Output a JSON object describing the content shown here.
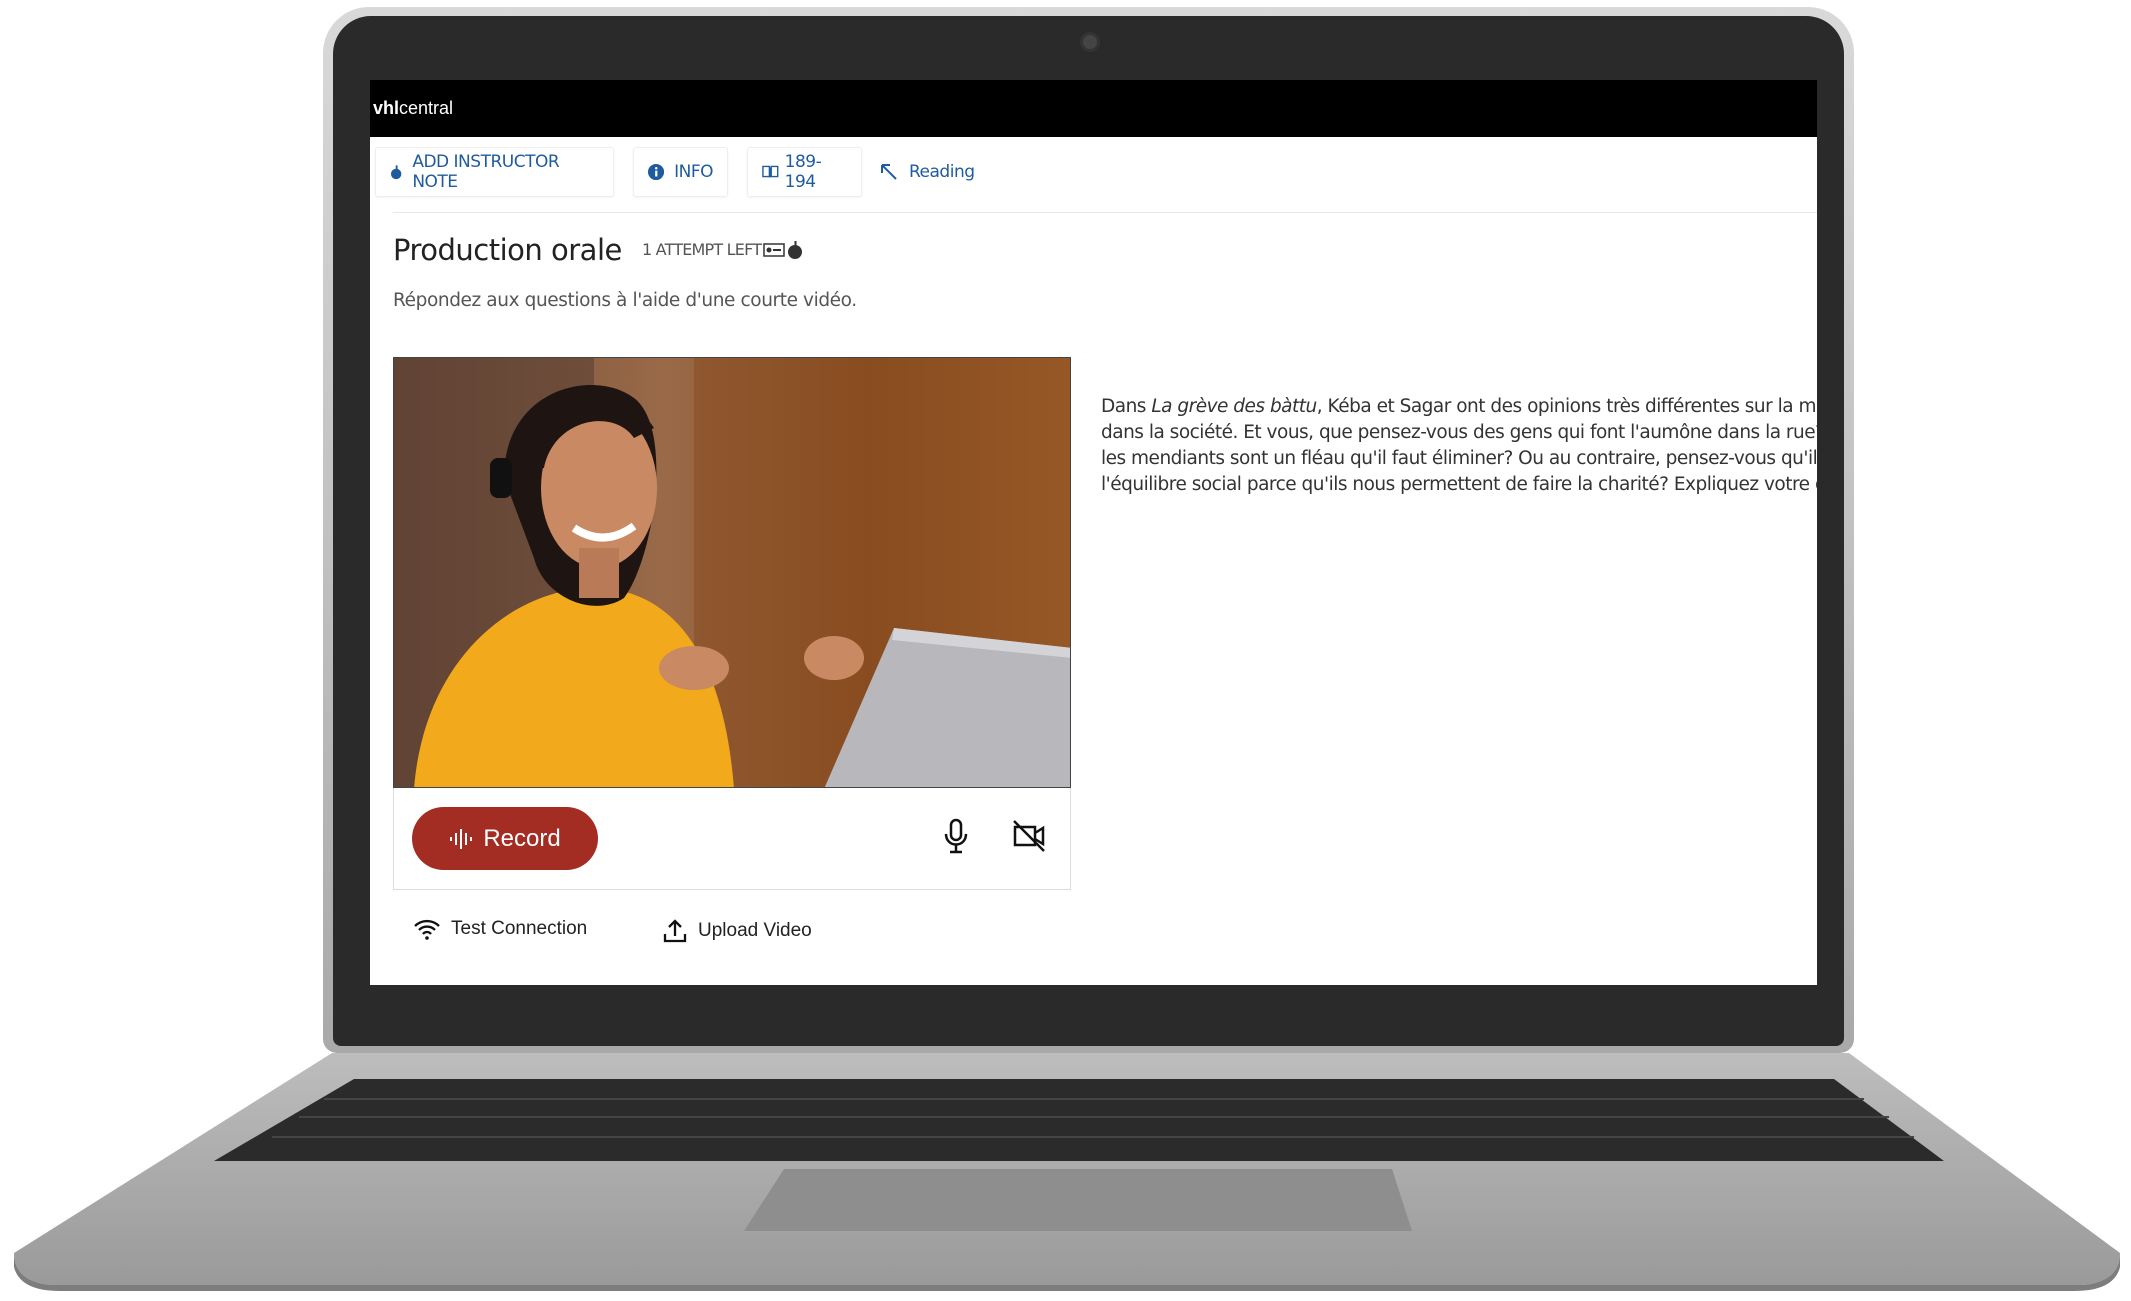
{
  "app": {
    "logo_bold": "vhl",
    "logo_rest": "central"
  },
  "toolbar": {
    "instructor_note": "ADD INSTRUCTOR NOTE",
    "info": "INFO",
    "pages": "189-194",
    "reading": "Reading"
  },
  "activity": {
    "title": "Production orale",
    "attempts": "1 ATTEMPT LEFT",
    "instructions": "Répondez aux questions à l'aide d'une courte vidéo."
  },
  "prompt": {
    "lines": [
      {
        "pre": "Dans ",
        "em": "La grève des bàttu",
        "post": ", Kéba et Sagar ont des opinions très différentes sur la mend"
      },
      {
        "text": "dans la société. Et vous, que pensez-vous des gens qui font l'aumône dans la rue? C"
      },
      {
        "text": "les mendiants sont un fléau qu'il faut éliminer? Ou au contraire, pensez-vous qu'ils s"
      },
      {
        "text": "l'équilibre social parce qu'ils nous permettent de faire la charité? Expliquez votre op"
      }
    ]
  },
  "recorder": {
    "record_label": "Record",
    "test_connection": "Test Connection",
    "upload_video": "Upload Video"
  },
  "colors": {
    "link": "#1f5b9f",
    "record": "#a32d22",
    "topbar": "#000000"
  },
  "icons": [
    "apple-icon",
    "info-icon",
    "book-icon",
    "arrow-up-left-icon",
    "rec-badge-icon",
    "waveform-icon",
    "microphone-icon",
    "camera-off-icon",
    "wifi-icon",
    "upload-icon"
  ]
}
